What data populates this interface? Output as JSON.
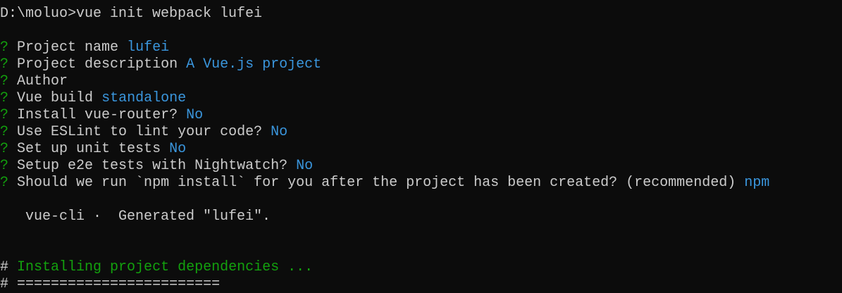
{
  "colors": {
    "background": "#0c0c0c",
    "text": "#cccccc",
    "green": "#13a10e",
    "blue": "#3a96dd"
  },
  "command_line": "D:\\moluo>vue init webpack lufei",
  "prompts": [
    {
      "mark": "?",
      "question": "Project name",
      "answer": "lufei"
    },
    {
      "mark": "?",
      "question": "Project description",
      "answer": "A Vue.js project"
    },
    {
      "mark": "?",
      "question": "Author",
      "answer": ""
    },
    {
      "mark": "?",
      "question": "Vue build",
      "answer": "standalone"
    },
    {
      "mark": "?",
      "question": "Install vue-router?",
      "answer": "No"
    },
    {
      "mark": "?",
      "question": "Use ESLint to lint your code?",
      "answer": "No"
    },
    {
      "mark": "?",
      "question": "Set up unit tests",
      "answer": "No"
    },
    {
      "mark": "?",
      "question": "Setup e2e tests with Nightwatch?",
      "answer": "No"
    },
    {
      "mark": "?",
      "question": "Should we run `npm install` for you after the project has been created? (recommended)",
      "answer": "npm"
    }
  ],
  "generated": "   vue-cli ·  Generated \"lufei\".",
  "installing": {
    "mark": "#",
    "text": "Installing project dependencies ..."
  },
  "divider": {
    "mark": "#",
    "text": "========================"
  }
}
